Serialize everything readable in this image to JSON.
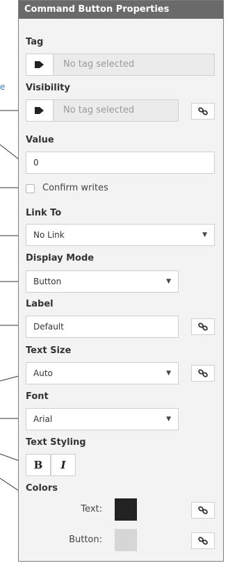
{
  "external_text": "e",
  "panel": {
    "title": "Command Button Properties"
  },
  "tag": {
    "label": "Tag",
    "placeholder": "No tag selected",
    "icon": "tag-icon"
  },
  "visibility": {
    "label": "Visibility",
    "placeholder": "No tag selected",
    "icon": "tag-icon",
    "link_icon": "link-icon"
  },
  "value": {
    "label": "Value",
    "value": "0"
  },
  "confirm": {
    "label": "Confirm writes",
    "checked": false
  },
  "link_to": {
    "label": "Link To",
    "selected": "No Link"
  },
  "display_mode": {
    "label": "Display Mode",
    "selected": "Button"
  },
  "label_field": {
    "label": "Label",
    "value": "Default",
    "link_icon": "link-icon"
  },
  "text_size": {
    "label": "Text Size",
    "selected": "Auto",
    "link_icon": "link-icon"
  },
  "font": {
    "label": "Font",
    "selected": "Arial"
  },
  "text_styling": {
    "label": "Text Styling",
    "bold": "B",
    "italic": "I"
  },
  "colors": {
    "label": "Colors",
    "text_label": "Text:",
    "text_color": "#222222",
    "button_label": "Button:",
    "button_color": "#d6d6d6"
  }
}
